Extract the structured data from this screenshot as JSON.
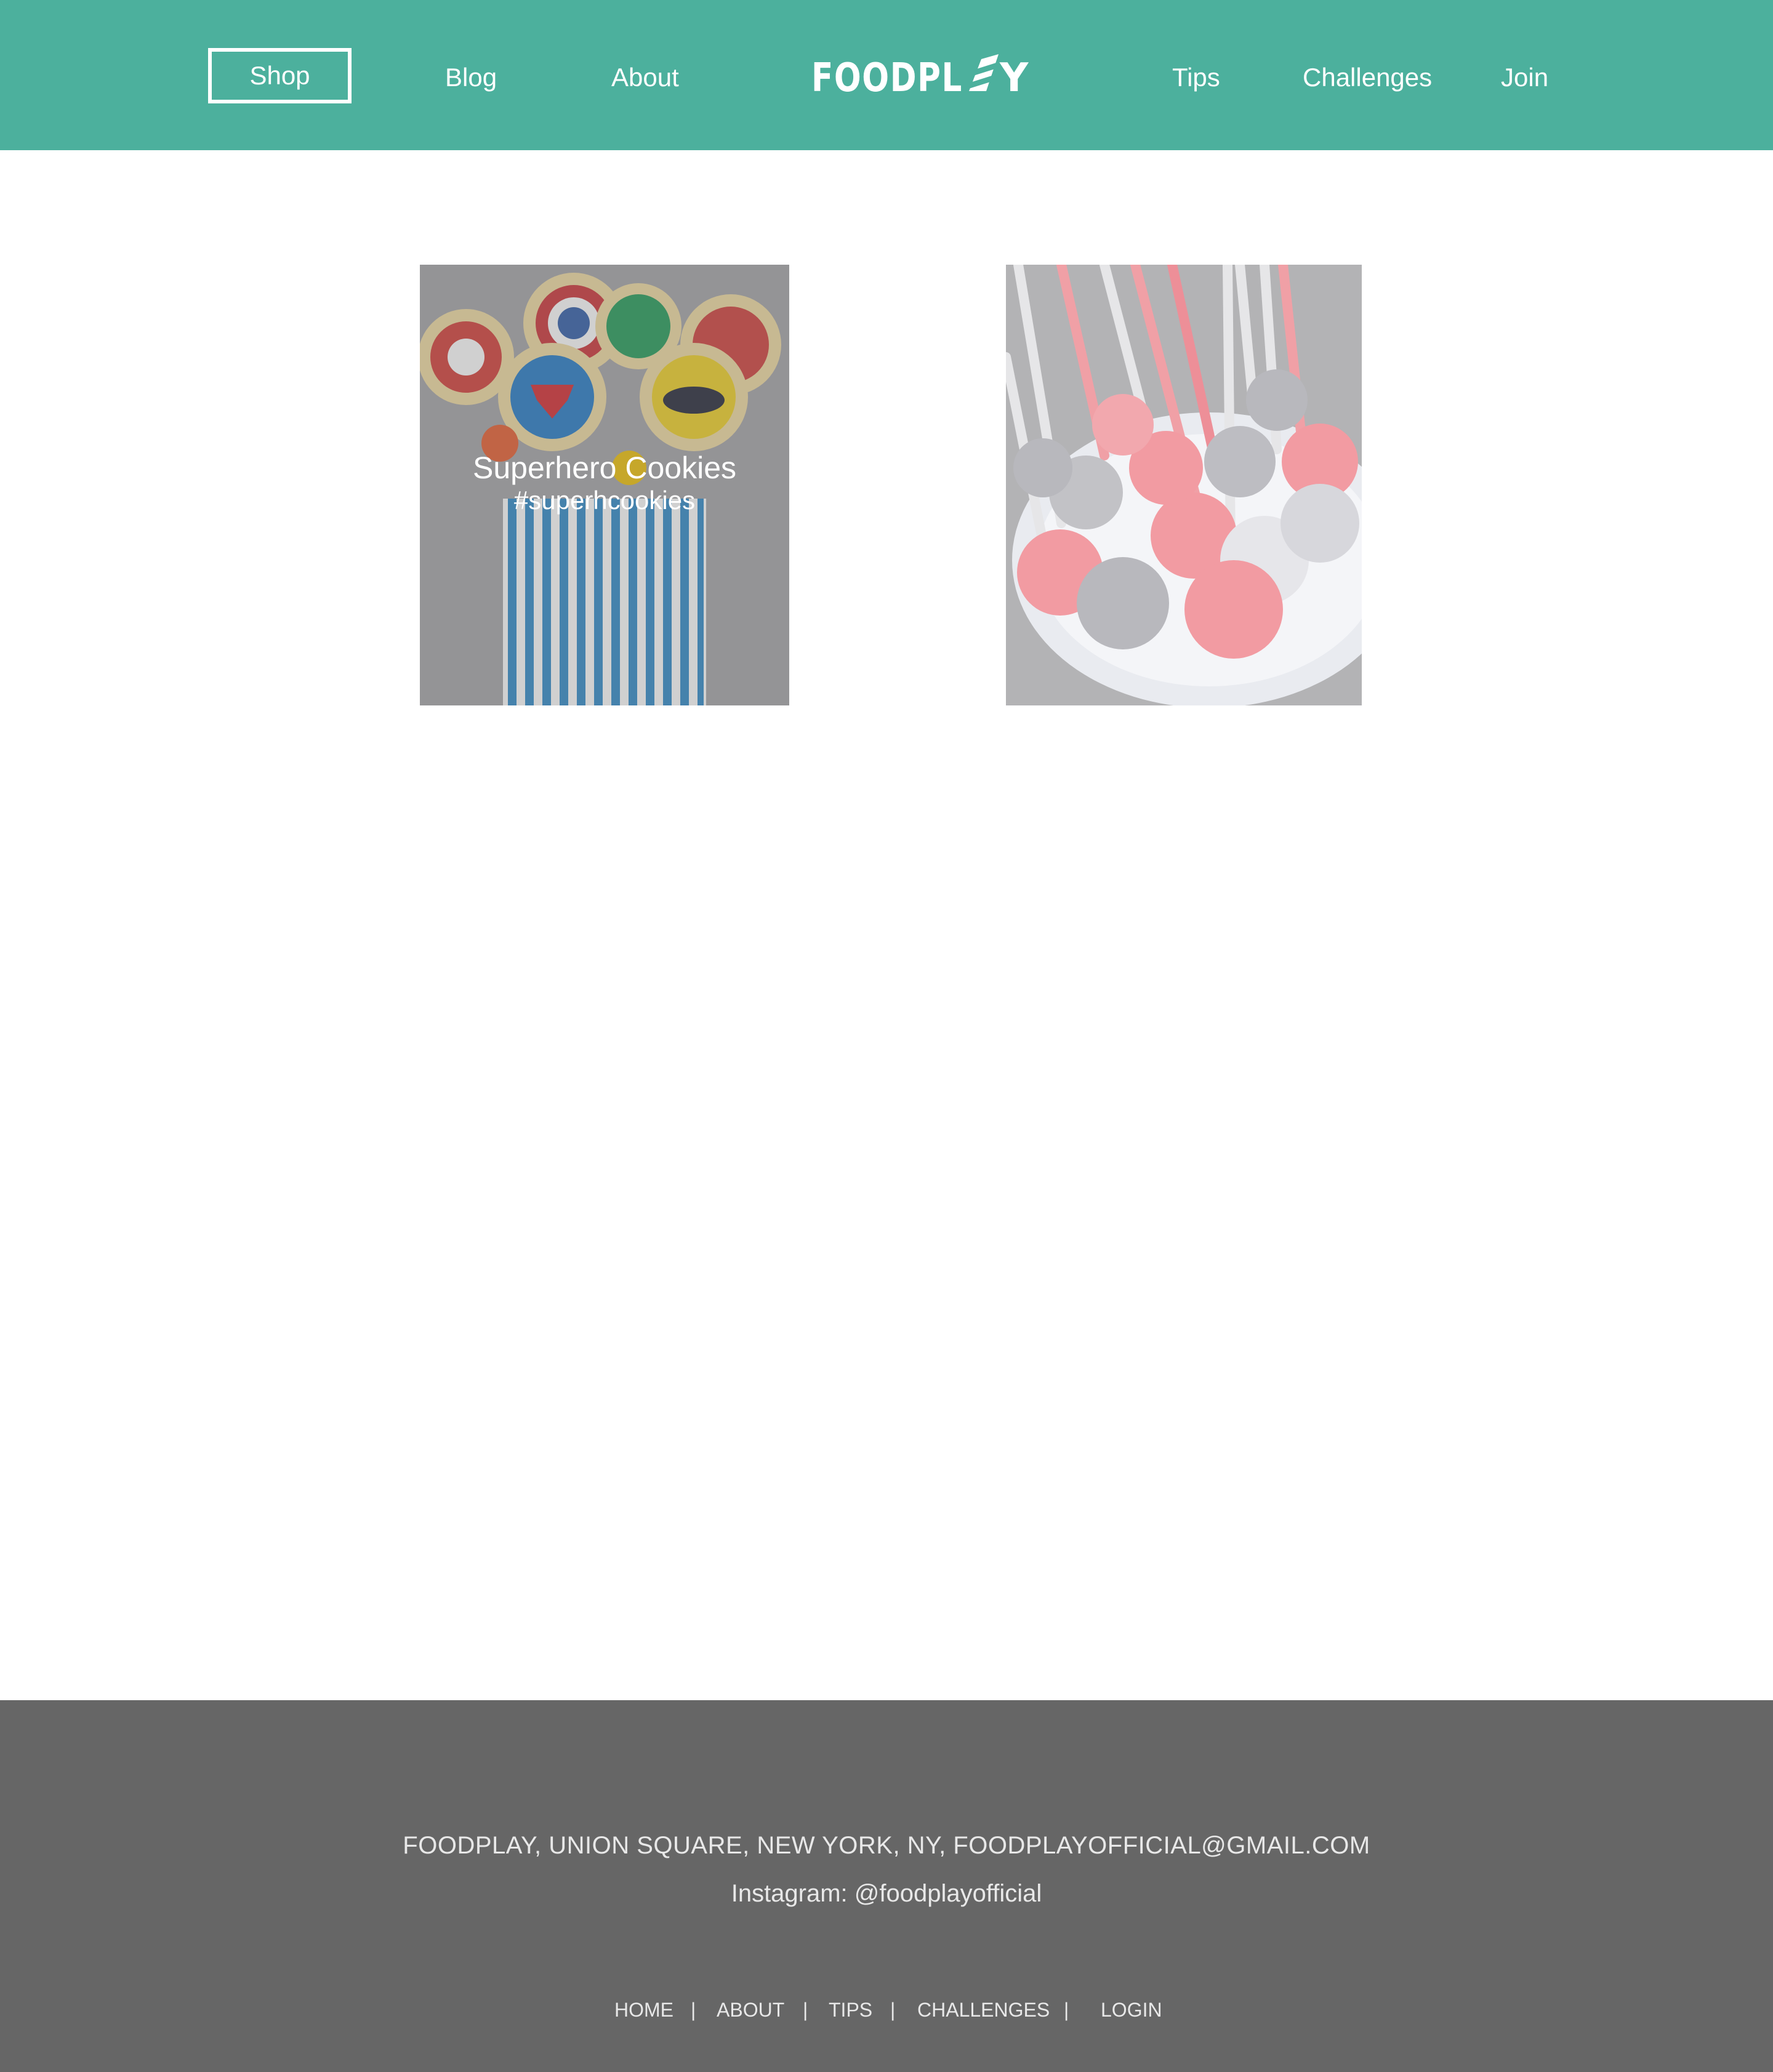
{
  "header": {
    "nav_left": [
      "Shop",
      "Blog",
      "About"
    ],
    "logo": "FOODPLAY",
    "nav_right": [
      "Tips",
      "Challenges",
      "Join"
    ]
  },
  "gallery": {
    "items": [
      {
        "title": "Superhero Cookies",
        "tag": "#superhcookies"
      },
      {
        "title": "",
        "tag": ""
      }
    ]
  },
  "footer": {
    "address": "FOODPLAY, UNION SQUARE, NEW YORK, NY, FOODPLAYOFFICIAL@GMAIL.COM",
    "instagram": "Instagram: @foodplayofficial",
    "links": [
      "HOME",
      "ABOUT",
      "TIPS",
      "CHALLENGES",
      "LOGIN"
    ],
    "separator": "|"
  },
  "colors": {
    "header_bg": "#4cb09d",
    "footer_bg": "#666666",
    "text_light": "#ffffff"
  }
}
